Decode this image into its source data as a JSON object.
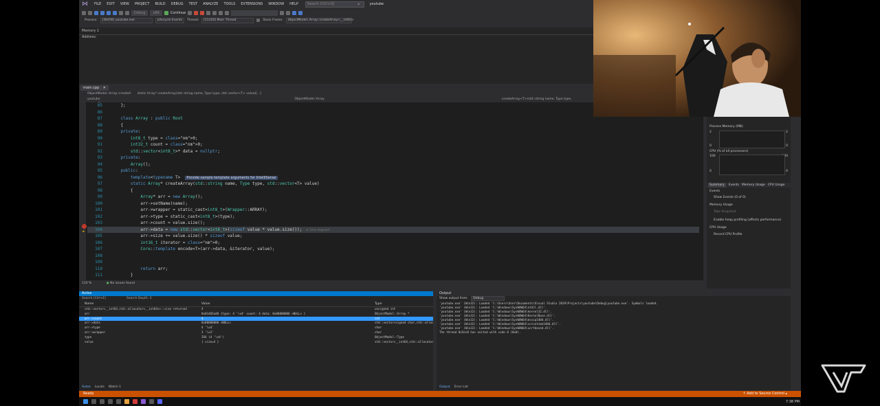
{
  "menubar": {
    "items": [
      "FILE",
      "EDIT",
      "VIEW",
      "PROJECT",
      "BUILD",
      "DEBUG",
      "TEST",
      "ANALYZE",
      "TOOLS",
      "EXTENSIONS",
      "WINDOW",
      "HELP"
    ],
    "search_placeholder": "Search (Ctrl+Q)",
    "project_name": "youtube"
  },
  "toolbar": {
    "config": "Debug",
    "platform": "x86",
    "continue_label": "Continue",
    "process_label": "Process:",
    "process_value": "[36456] youtube.exe",
    "lifecycle_label": "Lifecycle Events",
    "thread_label": "Thread:",
    "thread_value": "[21320] Main Thread",
    "stack_label": "Stack Frame:",
    "stack_value": "ObjectModel::Array::createArray<__int64>"
  },
  "memory": {
    "title": "Memory 1",
    "address_label": "Address:"
  },
  "doc": {
    "tab": "main.cpp",
    "nav_left": "ObjectModel::Array::createA",
    "nav_sig": "static Array* createArray(std::string name, Type type, std::vector<T> value)[...]",
    "nav2_project": "youtube",
    "nav2_scope": "ObjectModel::Array",
    "nav2_member": "createArray<T>(std::string name, Type type, std::vector<T> va"
  },
  "code": {
    "hint_text": "Provide sample template arguments for IntelliSense",
    "elapsed": "≤ 1ms elapsed",
    "lines": [
      {
        "n": "85",
        "t": "    };"
      },
      {
        "n": "86",
        "t": ""
      },
      {
        "n": "87",
        "t": "    class Array : public Root"
      },
      {
        "n": "88",
        "t": "    {"
      },
      {
        "n": "89",
        "t": "    private:"
      },
      {
        "n": "90",
        "t": "        int8_t type = 0;"
      },
      {
        "n": "91",
        "t": "        int32_t count = 0;"
      },
      {
        "n": "92",
        "t": "        std::vector<int8_t>* data = nullptr;"
      },
      {
        "n": "93",
        "t": "    private:"
      },
      {
        "n": "94",
        "t": "        Array();"
      },
      {
        "n": "95",
        "t": "    public:"
      },
      {
        "n": "96",
        "t": "        template<typename T>  "
      },
      {
        "n": "97",
        "t": "        static Array* createArray(std::string name, Type type, std::vector<T> value)"
      },
      {
        "n": "98",
        "t": "        {"
      },
      {
        "n": "99",
        "t": "            Array* arr = new Array();"
      },
      {
        "n": "100",
        "t": "            arr->setName(name);"
      },
      {
        "n": "101",
        "t": "            arr->wrapper = static_cast<int8_t>(Wrapper::ARRAY);"
      },
      {
        "n": "102",
        "t": "            arr->type = static_cast<int8_t>(type);"
      },
      {
        "n": "103",
        "t": "            arr->count = value.size();"
      },
      {
        "n": "104",
        "t": "            arr->data = new std::vector<int8_t>(sizeof value * value.size());"
      },
      {
        "n": "105",
        "t": "            arr->size += value.size() * sizeof value;"
      },
      {
        "n": "106",
        "t": "            int16_t iterator = 0;"
      },
      {
        "n": "107",
        "t": "            Core::template encode<T>(arr->data, &iterator, value);"
      },
      {
        "n": "108",
        "t": ""
      },
      {
        "n": "109",
        "t": ""
      },
      {
        "n": "110",
        "t": "            return arr;"
      },
      {
        "n": "111",
        "t": "        }"
      }
    ]
  },
  "editor_status": {
    "zoom": "110 %",
    "issues": "No issues found"
  },
  "diagnostics": {
    "process_memory": "Process Memory (MB)",
    "mem_max": "2",
    "mem_min": "0",
    "cpu": "CPU (% of all processors)",
    "cpu_max": "100",
    "cpu_min": "0",
    "tabs": [
      "Summary",
      "Events",
      "Memory Usage",
      "CPU Usage"
    ],
    "events_title": "Events",
    "show_events": "Show Events (0 of 0)",
    "memory_usage_title": "Memory Usage",
    "take_snapshot": "Take Snapshot",
    "heap_profiling": "Enable heap profiling (affects performance)",
    "cpu_usage_title": "CPU Usage",
    "record_cpu": "Record CPU Profile"
  },
  "autos": {
    "title": "Autos",
    "search_placeholder": "Search (Ctrl+E)",
    "search_depth_label": "Search Depth:",
    "search_depth_value": "3",
    "columns": [
      "Name",
      "Value",
      "Type"
    ],
    "rows": [
      {
        "name": "std::vector<__int64,std::allocator<__int64>>::size returned",
        "value": "4",
        "type": "unsigned int",
        "sel": false
      },
      {
        "name": "arr",
        "value": "0x01465a40 {type: 4 '\\x4' count: 4 data: 0x00000000 <NULL> }",
        "type": "ObjectModel::Array *",
        "sel": false
      },
      {
        "name": "arr->count",
        "value": "4",
        "type": "int",
        "sel": true
      },
      {
        "name": "arr->data",
        "value": "0x00000000 <NULL>",
        "type": "std::vector<signed char,std::allocat...",
        "sel": false
      },
      {
        "name": "arr->type",
        "value": "4 '\\x4'",
        "type": "char",
        "sel": false
      },
      {
        "name": "arr->wrapper",
        "value": "3 '\\x3'",
        "type": "char",
        "sel": false
      },
      {
        "name": "type",
        "value": "I64 (4 '\\x4')",
        "type": "ObjectModel::Type",
        "sel": false
      },
      {
        "name": "value",
        "value": "{ size=4 }",
        "type": "std::vector<__int64,std::allocator<__...",
        "sel": false
      }
    ],
    "bottom_tabs": [
      "Autos",
      "Locals",
      "Watch 1"
    ]
  },
  "output": {
    "title": "Output",
    "show_label": "Show output from:",
    "show_value": "Debug",
    "lines": [
      "'youtube.exe' (Win32): Loaded 'C:\\Users\\User\\Documents\\Visual Studio 2019\\Projects\\youtube\\Debug\\youtube.exe'. Symbols loaded.",
      "'youtube.exe' (Win32): Loaded 'C:\\Windows\\SysWOW64\\ntdll.dll'.",
      "'youtube.exe' (Win32): Loaded 'C:\\Windows\\SysWOW64\\kernel32.dll'.",
      "'youtube.exe' (Win32): Loaded 'C:\\Windows\\SysWOW64\\KernelBase.dll'.",
      "'youtube.exe' (Win32): Loaded 'C:\\Windows\\SysWOW64\\msvcp140d.dll'.",
      "'youtube.exe' (Win32): Loaded 'C:\\Windows\\SysWOW64\\vcruntime140d.dll'.",
      "'youtube.exe' (Win32): Loaded 'C:\\Windows\\SysWOW64\\ucrtbased.dll'.",
      "The thread 0x5ec8 has exited with code 0 (0x0)."
    ],
    "bottom_tabs": [
      "Output",
      "Error List"
    ]
  },
  "statusbar": {
    "ready": "Ready",
    "source_control": "↑ Add to Source Control ▴"
  },
  "taskbar": {
    "time": "7:38 PM"
  },
  "colors": {
    "accent": "#007acc",
    "statusbar": "#ca5100",
    "selection": "#3399ff",
    "breakpoint": "#c0392b"
  }
}
